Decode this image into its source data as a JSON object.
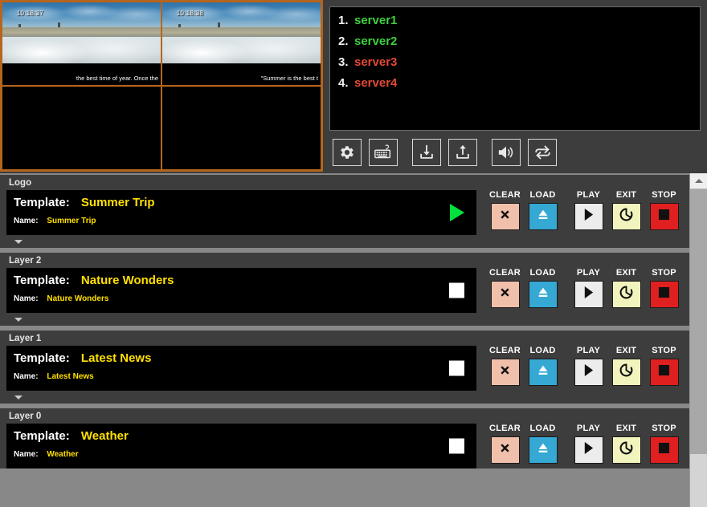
{
  "previews": [
    {
      "timecode": "10:18:37",
      "caption": "the best time of year. Once the",
      "state": "playing"
    },
    {
      "timecode": "10:18:38",
      "caption": "\"Summer is the best t",
      "state": "playing"
    },
    {
      "timecode": "",
      "caption": "",
      "state": "empty"
    },
    {
      "timecode": "",
      "caption": "",
      "state": "empty"
    }
  ],
  "servers": {
    "items": [
      {
        "index": "1.",
        "name": "server1",
        "status": "online"
      },
      {
        "index": "2.",
        "name": "server2",
        "status": "online"
      },
      {
        "index": "3.",
        "name": "server3",
        "status": "offline"
      },
      {
        "index": "4.",
        "name": "server4",
        "status": "offline"
      }
    ],
    "colors": {
      "online": "#3ecf3e",
      "offline": "#e24a35"
    }
  },
  "toolbar": {
    "items": [
      {
        "icon": "gear-icon",
        "name": "settings"
      },
      {
        "icon": "keyboard-icon",
        "name": "keyboard-shortcuts"
      },
      {
        "icon": "download-icon",
        "name": "download"
      },
      {
        "icon": "upload-icon",
        "name": "upload"
      },
      {
        "icon": "volume-icon",
        "name": "audio"
      },
      {
        "icon": "refresh-icon",
        "name": "refresh"
      }
    ]
  },
  "layer_buttons": {
    "clear_label": "CLEAR",
    "load_label": "LOAD",
    "play_label": "PLAY",
    "exit_label": "EXIT",
    "stop_label": "STOP",
    "colors": {
      "clear": "#f0c0ab",
      "load": "#36a8d4",
      "play": "#ececec",
      "exit": "#f2f4bd",
      "stop": "#e02020"
    }
  },
  "labels": {
    "template": "Template:",
    "name": "Name:"
  },
  "layers": [
    {
      "header": "Logo",
      "template": "Summer Trip",
      "name": "Summer Trip",
      "state": "playing"
    },
    {
      "header": "Layer 2",
      "template": "Nature Wonders",
      "name": "Nature Wonders",
      "state": "stopped"
    },
    {
      "header": "Layer 1",
      "template": "Latest News",
      "name": "Latest News",
      "state": "stopped"
    },
    {
      "header": "Layer 0",
      "template": "Weather",
      "name": "Weather",
      "state": "stopped"
    }
  ],
  "scrollbar": {
    "up_arrow": "scroll-up"
  }
}
